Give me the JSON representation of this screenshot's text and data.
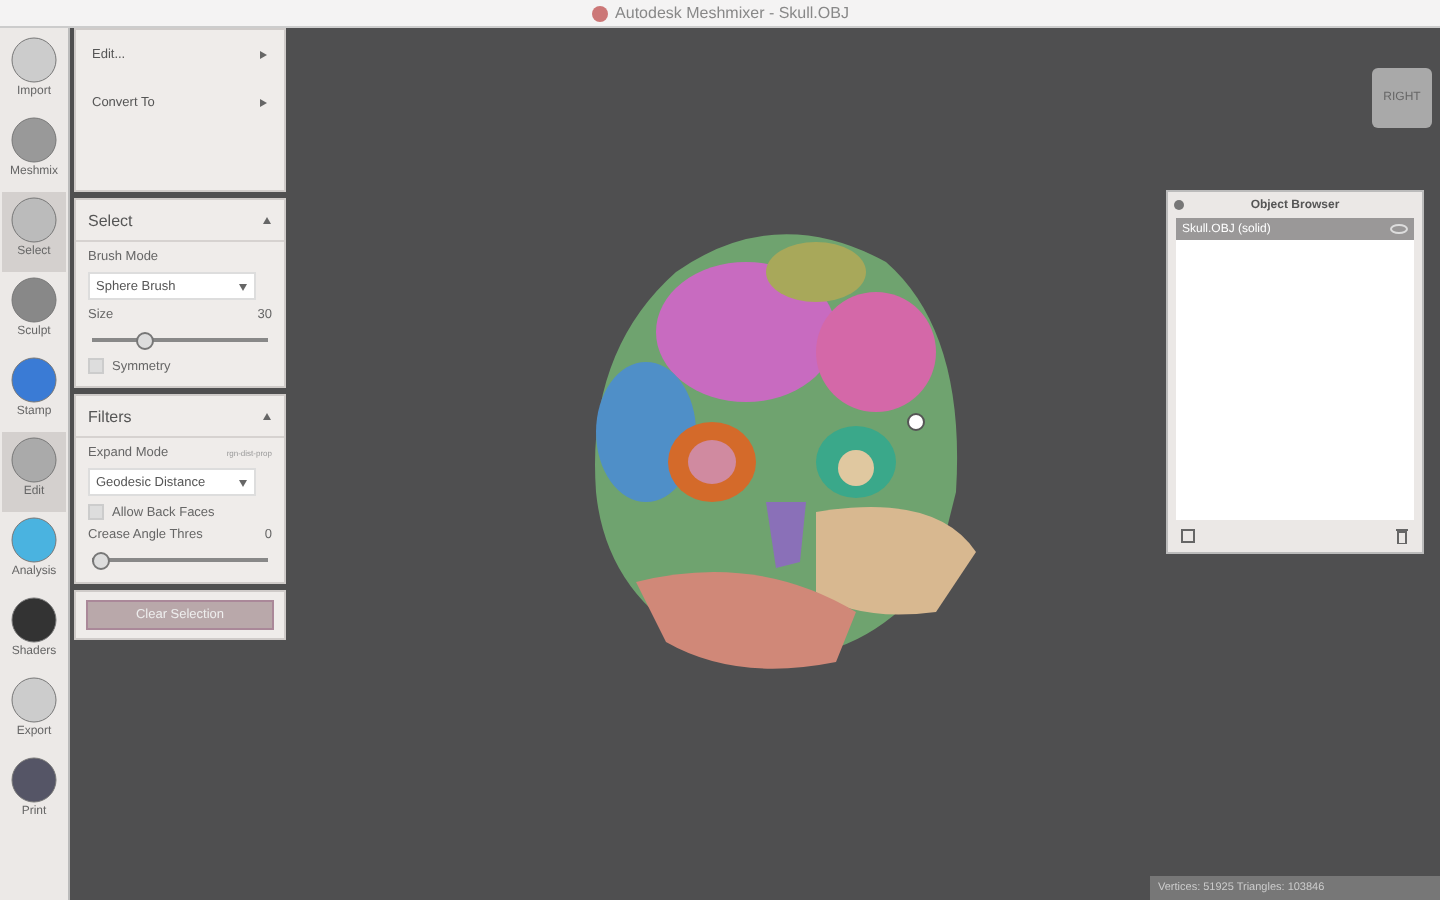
{
  "window": {
    "title": "Autodesk Meshmixer - Skull.OBJ"
  },
  "toolbar": [
    {
      "label": "Import",
      "selected": false
    },
    {
      "label": "Meshmix",
      "selected": false
    },
    {
      "label": "Select",
      "selected": true
    },
    {
      "label": "Sculpt",
      "selected": false
    },
    {
      "label": "Stamp",
      "selected": false
    },
    {
      "label": "Edit",
      "selected": true
    },
    {
      "label": "Analysis",
      "selected": false
    },
    {
      "label": "Shaders",
      "selected": false
    },
    {
      "label": "Export",
      "selected": false
    },
    {
      "label": "Print",
      "selected": false
    }
  ],
  "menu": {
    "items": [
      "Edit...",
      "Convert To"
    ]
  },
  "select_panel": {
    "title": "Select",
    "brush_mode_label": "Brush Mode",
    "brush_mode": "Sphere Brush",
    "size_label": "Size",
    "size_value": "30",
    "size_slider": {
      "level": 0.3
    },
    "symmetry_label": "Symmetry",
    "symmetry_checked": false
  },
  "filters_panel": {
    "title": "Filters",
    "expand_mode_label": "Expand Mode",
    "expand_hint": "rgn-dist-prop",
    "expand_mode": "Geodesic Distance",
    "allow_back_faces_label": "Allow Back Faces",
    "allow_back_faces_checked": false,
    "crease_label": "Crease Angle Thres",
    "crease_value": "0",
    "crease_slider": {
      "level": 0
    }
  },
  "clear_button": "Clear Selection",
  "nav_cube": "RIGHT",
  "object_browser": {
    "title": "Object Browser",
    "items": [
      {
        "label": "Skull.OBJ (solid)",
        "selected": true
      }
    ]
  },
  "status_bar": "Vertices: 51925 Triangles: 103846"
}
